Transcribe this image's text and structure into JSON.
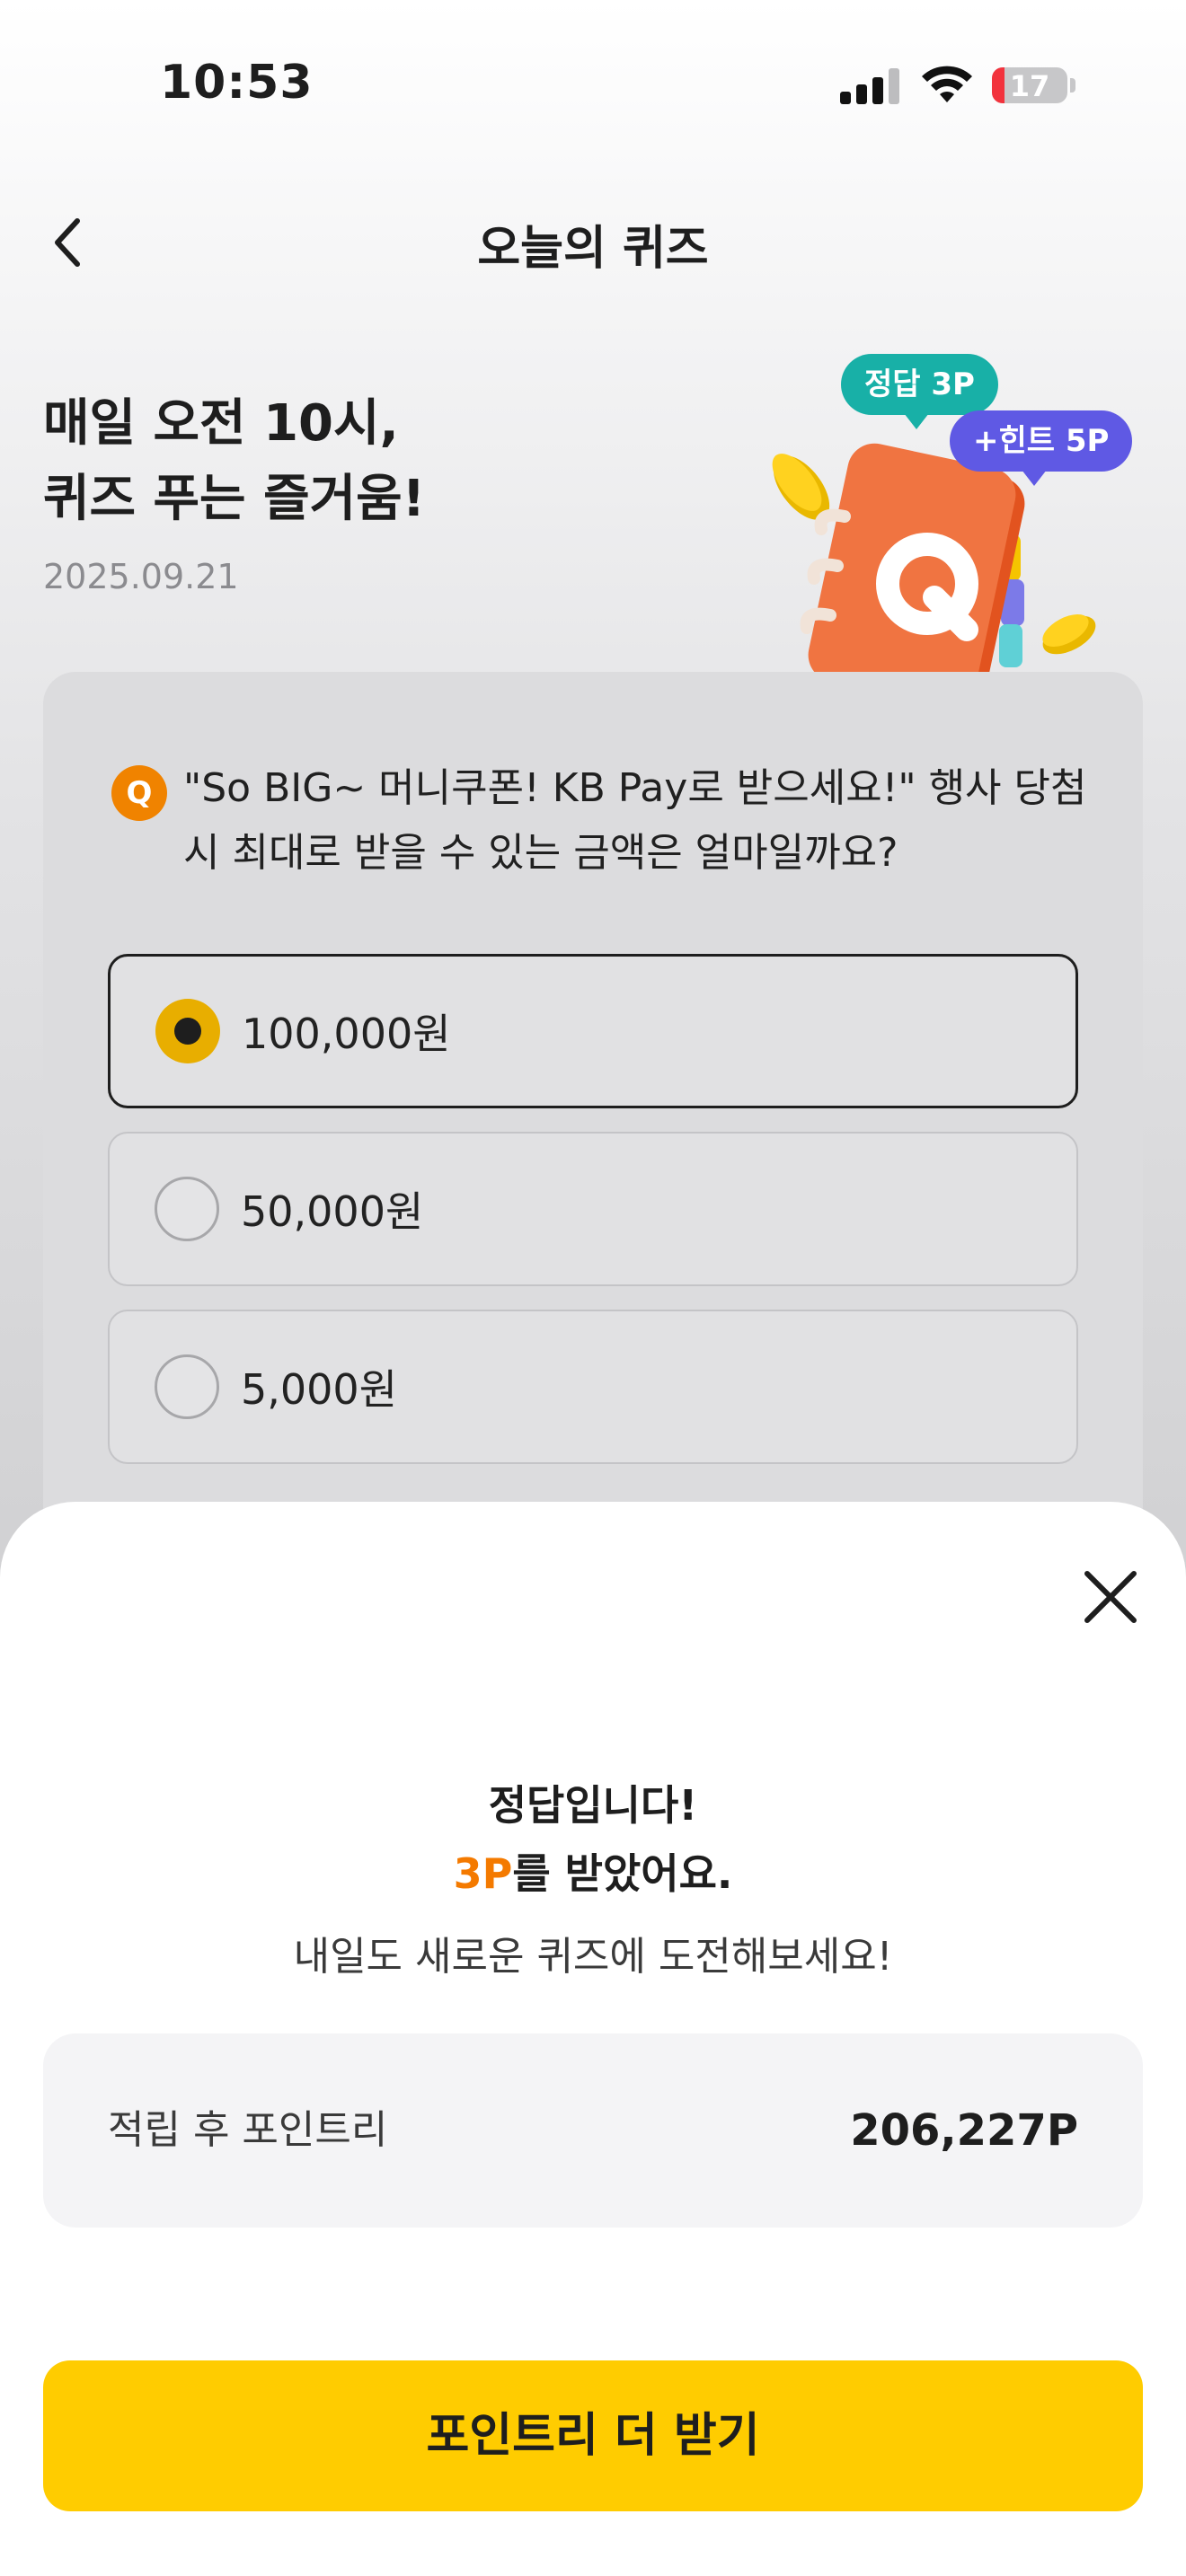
{
  "status_bar": {
    "time": "10:53",
    "battery_level": "17",
    "battery_fraction": 0.17
  },
  "nav": {
    "title": "오늘의 퀴즈",
    "back_icon": "chevron-left-icon"
  },
  "hero": {
    "title_line1": "매일 오전 10시,",
    "title_line2": "퀴즈 푸는 즐거움!",
    "date": "2025.09.21",
    "badge_answer": "정답 3P",
    "badge_hint": "+힌트 5P",
    "illustration_letter": "Q",
    "illustration": "notebook-q-icon"
  },
  "quiz": {
    "badge": "Q",
    "question": "\"So BIG~ 머니쿠폰! KB Pay로 받으세요!\" 행사 당첨 시 최대로 받을 수 있는 금액은 얼마일까요?",
    "options": [
      {
        "label": "100,000원",
        "selected": true
      },
      {
        "label": "50,000원",
        "selected": false
      },
      {
        "label": "5,000원",
        "selected": false
      }
    ]
  },
  "result_sheet": {
    "close_icon": "close-icon",
    "title": "정답입니다!",
    "points_earned": "3P",
    "points_suffix": "를 받았어요.",
    "subtitle": "내일도 새로운 퀴즈에 도전해보세요!",
    "balance_label": "적립 후 포인트리",
    "balance_value": "206,227P",
    "cta_label": "포인트리 더 받기"
  },
  "colors": {
    "accent_orange": "#f47a00",
    "cta_yellow": "#ffcc00",
    "radio_selected": "#e8ae00",
    "badge_teal": "#18b0a7",
    "badge_purple": "#5f59e4",
    "battery_red": "#f2333d"
  }
}
